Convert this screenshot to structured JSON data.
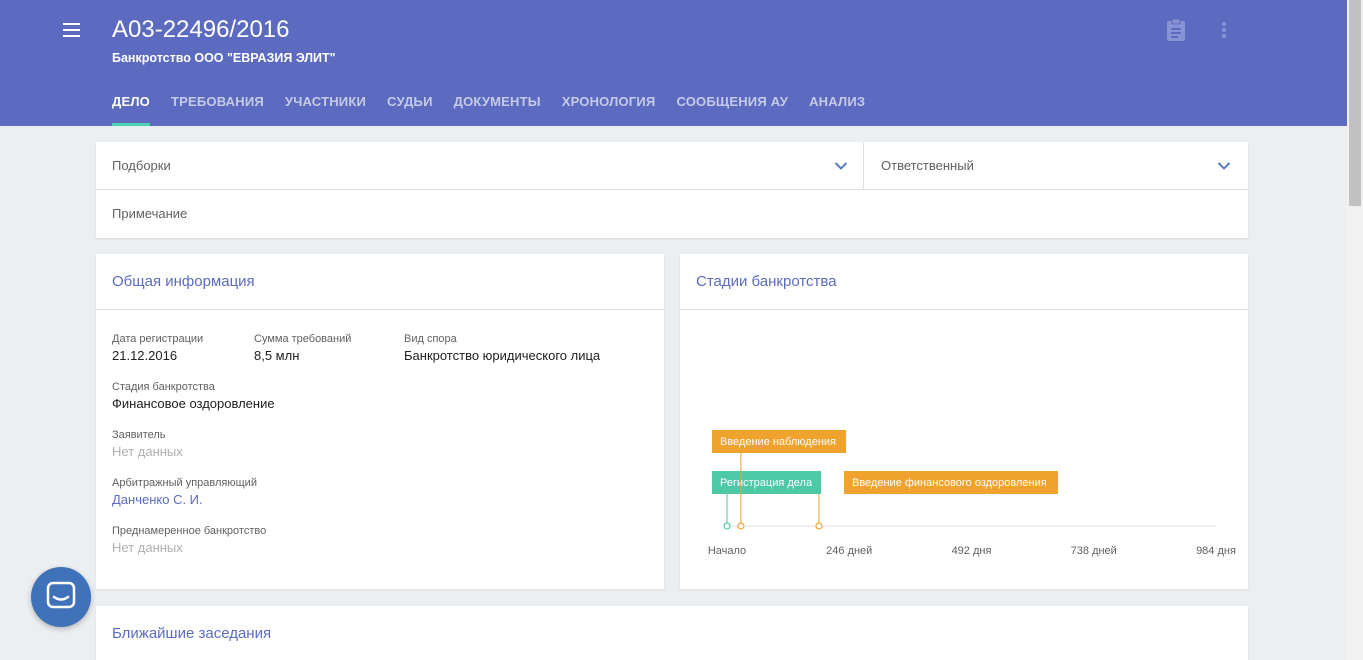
{
  "header": {
    "case_number": "А03-22496/2016",
    "case_subtitle": "Банкротство ООО \"ЕВРАЗИЯ ЭЛИТ\"",
    "tabs": [
      {
        "label": "ДЕЛО",
        "active": true
      },
      {
        "label": "ТРЕБОВАНИЯ"
      },
      {
        "label": "УЧАСТНИКИ"
      },
      {
        "label": "СУДЬИ"
      },
      {
        "label": "ДОКУМЕНТЫ"
      },
      {
        "label": "ХРОНОЛОГИЯ"
      },
      {
        "label": "СООБЩЕНИЯ АУ"
      },
      {
        "label": "АНАЛИЗ"
      }
    ],
    "icons": [
      "menu-icon",
      "clipboard-icon",
      "more-vert-icon"
    ]
  },
  "filters": {
    "collections_placeholder": "Подборки",
    "responsible_placeholder": "Ответственный",
    "note_placeholder": "Примечание"
  },
  "general_info": {
    "title": "Общая информация",
    "fields": {
      "reg_date": {
        "label": "Дата регистрации",
        "value": "21.12.2016"
      },
      "claims_sum": {
        "label": "Сумма требований",
        "value": "8,5 млн"
      },
      "dispute_type": {
        "label": "Вид спора",
        "value": "Банкротство юридического лица"
      },
      "stage": {
        "label": "Стадия банкротства",
        "value": "Финансовое оздоровление"
      },
      "applicant": {
        "label": "Заявитель",
        "value": "Нет данных"
      },
      "manager": {
        "label": "Арбитражный управляющий",
        "value": "Данченко С. И."
      },
      "deliberate": {
        "label": "Преднамеренное банкротство",
        "value": "Нет данных"
      }
    }
  },
  "stages": {
    "title": "Стадии банкротства",
    "axis_labels": [
      "Начало",
      "246 дней",
      "492 дня",
      "738 дней",
      "984 дня"
    ],
    "axis_max_days": 984,
    "events": [
      {
        "label": "Регистрация дела",
        "day": 0,
        "color": "#4dc9a5"
      },
      {
        "label": "Введение наблюдения",
        "day": 28,
        "color": "#f0a22e"
      },
      {
        "label": "Введение финансового оздоровления",
        "day": 185,
        "color": "#f0a22e"
      }
    ]
  },
  "sessions": {
    "title": "Ближайшие заседания"
  },
  "colors": {
    "header": "#5c6bc0",
    "tab_indicator": "#4dd0b1",
    "accent_text": "#5c6bc0",
    "chat_button": "#3f72b8"
  }
}
